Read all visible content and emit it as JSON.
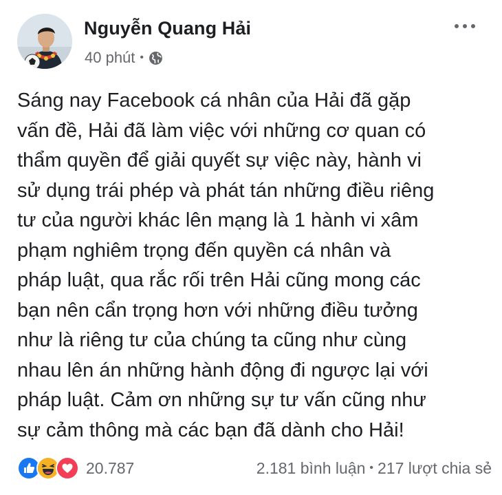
{
  "post": {
    "author": "Nguyễn Quang Hải",
    "time": "40 phút",
    "meta_separator": "•",
    "audience_icon": "globe-icon",
    "more_icon": "more-options-icon",
    "text_lines": [
      "Sáng nay Facebook cá nhân của Hải đã gặp",
      "vấn đề, Hải đã làm việc với những cơ quan có",
      "thẩm quyền để giải quyết sự việc này, hành vi",
      "sử dụng trái phép và phát tán những điều riêng",
      "tư của người khác lên mạng là 1 hành vi xâm",
      "phạm nghiêm trọng đến quyền cá nhân và",
      "pháp luật, qua rắc rối trên Hải cũng mong các",
      "bạn nên cẩn trọng hơn với những điều tưởng",
      "như là riêng tư của chúng ta cũng như cùng",
      "nhau lên án những hành động đi ngược lại với",
      "pháp luật. Cảm ơn những sự tư vấn cũng như",
      "sự cảm thông mà các bạn đã dành cho Hải!"
    ]
  },
  "footer": {
    "reaction_icons": [
      "like-icon",
      "haha-icon",
      "love-icon"
    ],
    "reaction_count": "20.787",
    "comments": "2.181 bình luận",
    "separator": "•",
    "shares": "217 lượt chia sẻ"
  },
  "colors": {
    "text": "#1c1e21",
    "secondary": "#65676b",
    "like": "#1877f2",
    "love": "#f33e58",
    "haha": "#f7b125"
  }
}
